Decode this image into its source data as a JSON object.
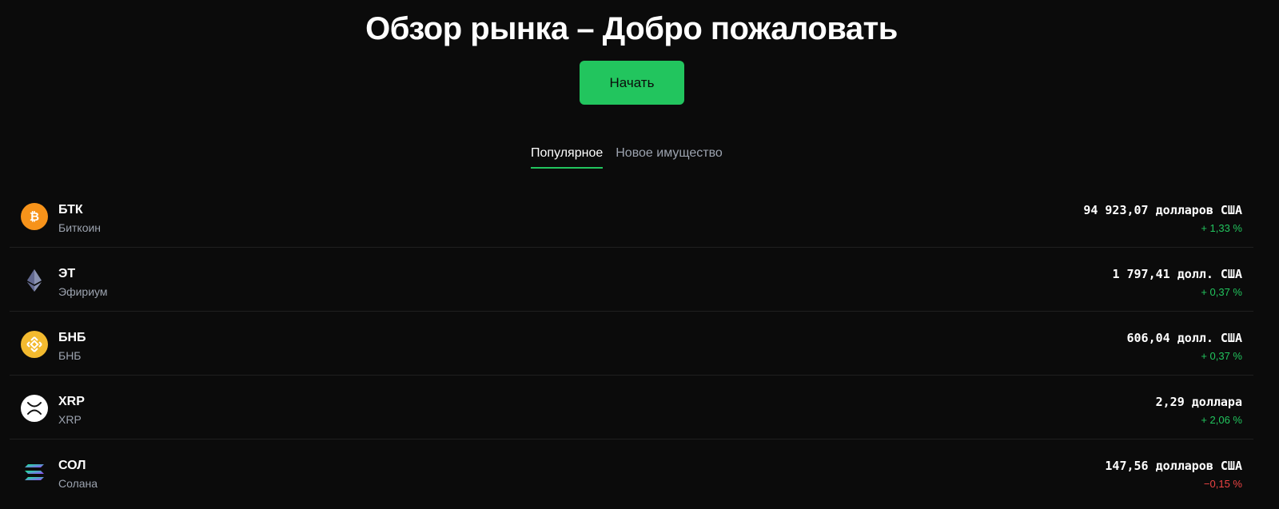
{
  "header": {
    "title": "Обзор рынка – Добро пожаловать",
    "cta_label": "Начать"
  },
  "tabs": [
    {
      "label": "Популярное",
      "active": true
    },
    {
      "label": "Новое имущество",
      "active": false
    }
  ],
  "colors": {
    "accent": "#22c55e",
    "positive": "#22c55e",
    "negative": "#ef4444",
    "background": "#0b0b0b"
  },
  "assets": [
    {
      "symbol": "БТК",
      "name": "Биткоин",
      "price": "94 923,07 долларов США",
      "change": "+ 1,33 %",
      "direction": "up",
      "icon": "bitcoin-icon"
    },
    {
      "symbol": "ЭТ",
      "name": "Эфириум",
      "price": "1 797,41 долл. США",
      "change": "+ 0,37 %",
      "direction": "up",
      "icon": "ethereum-icon"
    },
    {
      "symbol": "БНБ",
      "name": "БНБ",
      "price": "606,04 долл. США",
      "change": "+ 0,37 %",
      "direction": "up",
      "icon": "bnb-icon"
    },
    {
      "symbol": "XRP",
      "name": "XRP",
      "price": "2,29 доллара",
      "change": "+ 2,06 %",
      "direction": "up",
      "icon": "xrp-icon"
    },
    {
      "symbol": "СОЛ",
      "name": "Солана",
      "price": "147,56 долларов США",
      "change": "−0,15 %",
      "direction": "down",
      "icon": "solana-icon"
    }
  ]
}
